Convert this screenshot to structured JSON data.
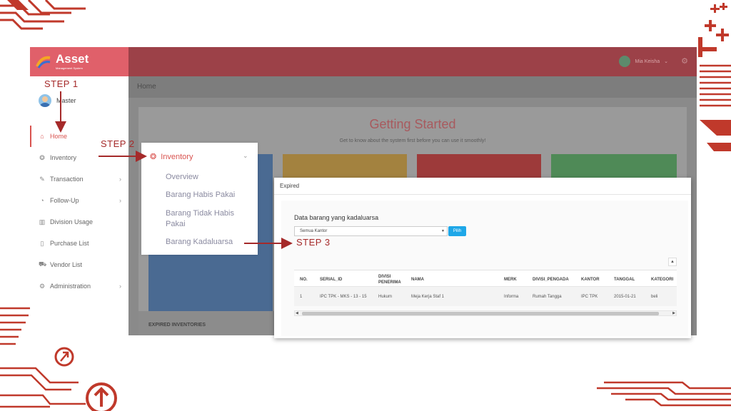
{
  "app": {
    "logo_title": "Asset",
    "logo_subtitle": "Management System",
    "breadcrumb": "Home",
    "user_name": "Master",
    "account_name": "Mia Keisha"
  },
  "sidebar": {
    "items": [
      {
        "label": "Home",
        "icon": "home-icon"
      },
      {
        "label": "Inventory",
        "icon": "box-icon"
      },
      {
        "label": "Transaction",
        "icon": "edit-icon"
      },
      {
        "label": "Follow-Up",
        "icon": "chevron-circle-icon"
      },
      {
        "label": "Division Usage",
        "icon": "bar-chart-icon"
      },
      {
        "label": "Purchase List",
        "icon": "clipboard-icon"
      },
      {
        "label": "Vendor List",
        "icon": "cart-icon"
      },
      {
        "label": "Administration",
        "icon": "gear-icon"
      }
    ]
  },
  "dashboard": {
    "title": "Getting Started",
    "subtitle": "Get to know about the system first before you can use it smoothly!",
    "expired_section": "EXPIRED INVENTORIES"
  },
  "steps": {
    "step1": "STEP 1",
    "step2": "STEP 2",
    "step3": "STEP 3"
  },
  "inventory_menu": {
    "header": "Inventory",
    "items": [
      "Overview",
      "Barang Habis Pakai",
      "Barang Tidak Habis Pakai",
      "Barang Kadaluarsa"
    ]
  },
  "expired_window": {
    "title": "Expired",
    "heading": "Data barang yang kadaluarsa",
    "select_value": "Semua Kantor",
    "button": "Pilih",
    "columns": [
      "NO.",
      "SERIAL_ID",
      "DIVISI PENERIMA",
      "NAMA",
      "MERK",
      "DIVISI_PENGADA",
      "KANTOR",
      "TANGGAL",
      "KATEGORI"
    ],
    "rows": [
      [
        "1",
        "IPC TPK - MKS - 13 - 15",
        "Hukum",
        "Meja Kerja Staf 1",
        "Informa",
        "Rumah Tangga",
        "IPC TPK",
        "2015-01-21",
        "beli"
      ]
    ]
  },
  "colors": {
    "brand": "#e0606a",
    "step_text": "#a52a2a",
    "accent_button": "#1ea7e8"
  }
}
